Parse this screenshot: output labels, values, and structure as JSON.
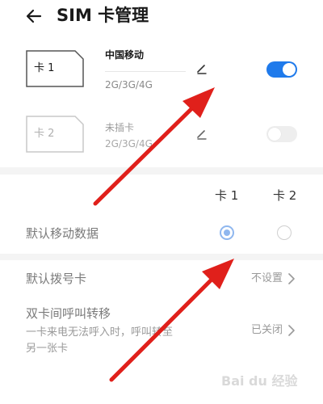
{
  "header": {
    "title": "SIM 卡管理"
  },
  "sim1": {
    "card_label": "卡 1",
    "carrier": "中国移动",
    "network": "2G/3G/4G",
    "enabled": true
  },
  "sim2": {
    "card_label": "卡 2",
    "carrier": "未插卡",
    "network": "2G/3G/4G",
    "enabled": false
  },
  "columns": {
    "card1": "卡 1",
    "card2": "卡 2"
  },
  "default_data": {
    "label": "默认移动数据",
    "selected": "card1"
  },
  "default_dial": {
    "label": "默认拨号卡",
    "value": "不设置"
  },
  "call_forward": {
    "label": "双卡间呼叫转移",
    "description": "一卡来电无法呼入时，呼叫转至另一张卡",
    "value": "已关闭"
  },
  "colors": {
    "accent": "#1f7aeb",
    "annotation_arrow": "#e0201b"
  },
  "watermark": {
    "text": "Bai du 经验"
  }
}
